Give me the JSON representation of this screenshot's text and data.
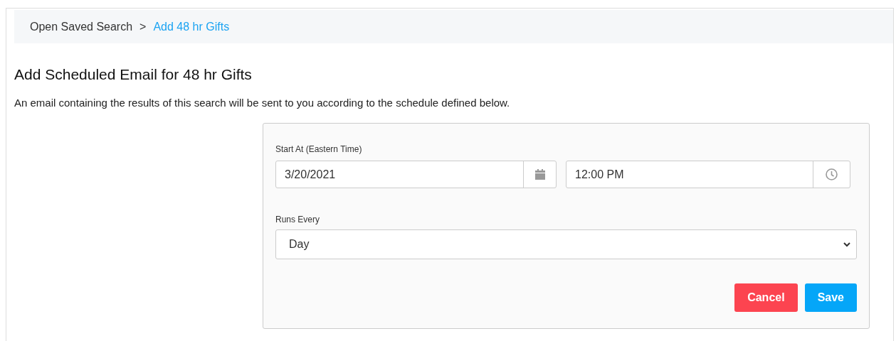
{
  "breadcrumb": [
    {
      "label": "Open Saved Search",
      "current": false
    },
    {
      "label": "Add 48 hr Gifts",
      "current": true
    }
  ],
  "breadcrumb_separator": ">",
  "title": "Add Scheduled Email for 48 hr Gifts",
  "description": "An email containing the results of this search will be sent to you according to the schedule defined below.",
  "form": {
    "start_label": "Start At (Eastern Time)",
    "date": "3/20/2021",
    "time": "12:00 PM",
    "runs_label": "Runs Every",
    "runs_value": "Day",
    "buttons": [
      {
        "label": "Cancel",
        "kind": "danger"
      },
      {
        "label": "Save",
        "kind": "primary"
      }
    ]
  }
}
